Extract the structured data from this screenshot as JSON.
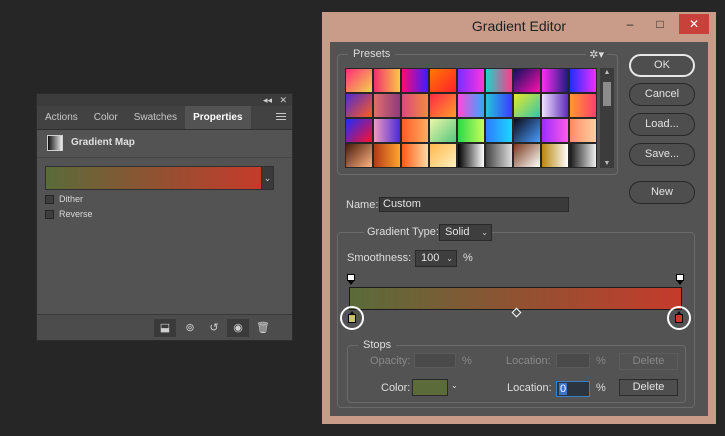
{
  "properties_panel": {
    "collapse_glyph": "◂◂",
    "close_glyph": "✕",
    "tabs": [
      {
        "label": "Actions"
      },
      {
        "label": "Color"
      },
      {
        "label": "Swatches"
      },
      {
        "label": "Properties"
      }
    ],
    "active_tab": "Properties",
    "header_title": "Gradient Map",
    "gradient": {
      "start_color": "#5a6b3a",
      "end_color": "#c63a2b"
    },
    "options": [
      {
        "label": "Dither",
        "checked": false
      },
      {
        "label": "Reverse",
        "checked": false
      }
    ],
    "footer_icons": [
      "clip-to-layer-icon",
      "view-previous-icon",
      "reset-icon",
      "visibility-eye-icon",
      "trash-icon"
    ]
  },
  "editor": {
    "title": "Gradient Editor",
    "window_controls": {
      "minimize": "–",
      "maximize": "□",
      "close": "✕"
    },
    "presets_label": "Presets",
    "presets_menu_glyph": "✲▾",
    "buttons": {
      "ok": "OK",
      "cancel": "Cancel",
      "load": "Load...",
      "save": "Save...",
      "new": "New"
    },
    "name_label": "Name:",
    "name_value": "Custom",
    "gradient_type_label": "Gradient Type:",
    "gradient_type_value": "Solid",
    "smoothness_label": "Smoothness:",
    "smoothness_value": "100",
    "smoothness_unit": "%",
    "gradient": {
      "start_color": "#5a6b3a",
      "end_color": "#c63a2b"
    },
    "stops": {
      "label": "Stops",
      "opacity_label": "Opacity:",
      "opacity_unit": "%",
      "opacity_location_label": "Location:",
      "opacity_location_unit": "%",
      "opacity_delete": "Delete",
      "color_label": "Color:",
      "color_value": "#5b6b3a",
      "color_location_label": "Location:",
      "color_location_value": "0",
      "color_location_unit": "%",
      "color_delete": "Delete"
    },
    "color_stops": [
      {
        "location": 0,
        "color": "#c9c26e"
      },
      {
        "location": 100,
        "color": "#c63a2b"
      }
    ]
  }
}
